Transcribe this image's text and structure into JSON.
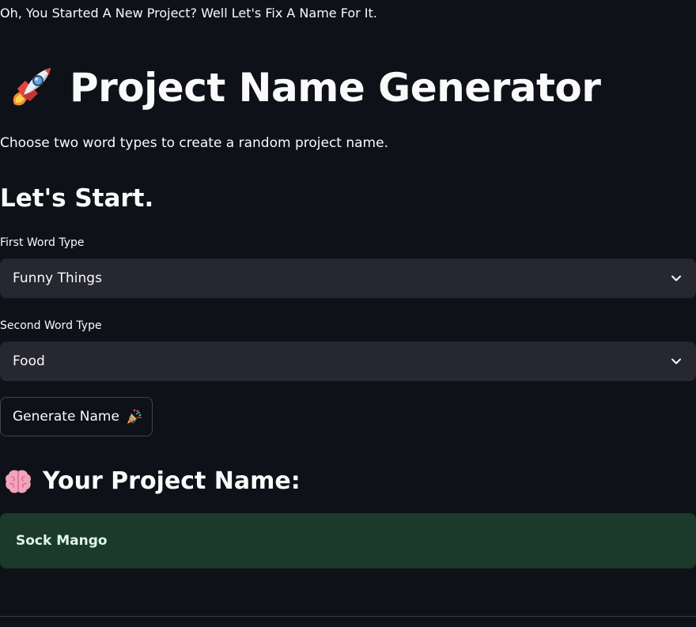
{
  "tagline": "Oh, You Started A New Project? Well Let's Fix A Name For It.",
  "header": {
    "icon": "rocket-icon",
    "title": "Project Name Generator"
  },
  "subtitle": "Choose two word types to create a random project name.",
  "section_heading": "Let's Start.",
  "first_word": {
    "label": "First Word Type",
    "selected": "Funny Things"
  },
  "second_word": {
    "label": "Second Word Type",
    "selected": "Food"
  },
  "generate_button": {
    "label": "Generate Name",
    "icon": "party-popper-icon"
  },
  "result": {
    "icon": "brain-icon",
    "heading": "Your Project Name:",
    "value": "Sock Mango"
  },
  "colors": {
    "background": "#0e1117",
    "select_background": "#262730",
    "success_background": "#1b3a2c",
    "text": "#fafafa"
  }
}
